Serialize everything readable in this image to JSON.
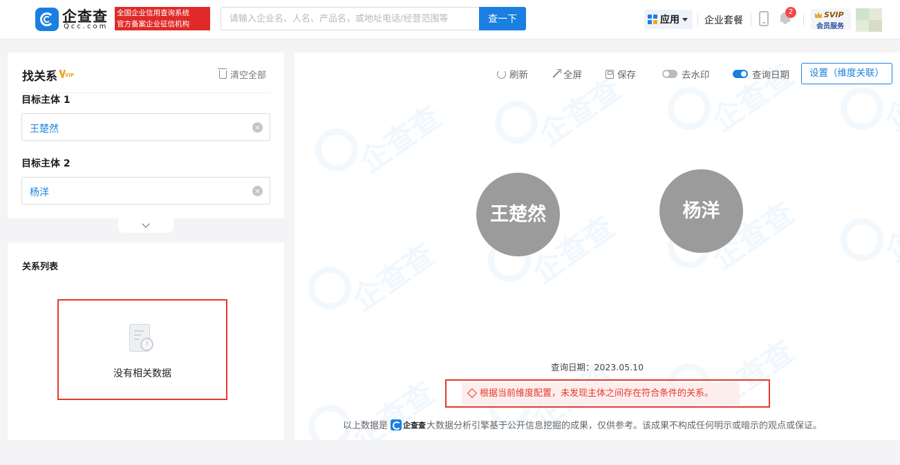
{
  "header": {
    "logo_name": "企查查",
    "logo_sub": "Qcc.com",
    "slogan_line1": "全国企业信用查询系统",
    "slogan_line2": "官方备案企业征信机构",
    "search_placeholder": "请输入企业名、人名、产品名，或地址电话/经营范围等",
    "search_button": "查一下",
    "apps_label": "应用",
    "package_label": "企业套餐",
    "notification_count": "2",
    "svip_line1": "SVIP",
    "svip_line2": "会员服务"
  },
  "finder": {
    "title": "找关系",
    "vip_badge": "VIP",
    "clear_all": "清空全部",
    "target1_label": "目标主体 1",
    "target1_value": "王楚然",
    "target2_label": "目标主体 2",
    "target2_value": "杨洋"
  },
  "relation_list": {
    "title": "关系列表",
    "empty_text": "没有相关数据"
  },
  "graph": {
    "toolbar": {
      "refresh": "刷新",
      "fullscreen": "全屏",
      "save": "保存",
      "remove_watermark": "去水印",
      "query_date": "查询日期",
      "settings": "设置（维度关联）"
    },
    "node_a": "王楚然",
    "node_b": "杨洋",
    "query_date_text": "查询日期：2023.05.10",
    "alert_text": "根据当前维度配置，未发现主体之间存在符合条件的关系。",
    "disclaimer_prefix": "以上数据是",
    "disclaimer_logo": "企查查",
    "disclaimer_suffix": "大数据分析引擎基于公开信息挖掘的成果，仅供参考。该成果不构成任何明示或暗示的观点或保证。",
    "watermark_text": "企查查"
  },
  "colors": {
    "brand_blue": "#1a7fe0",
    "alert_red": "#e5392b",
    "node_gray": "#9b9b9b"
  }
}
